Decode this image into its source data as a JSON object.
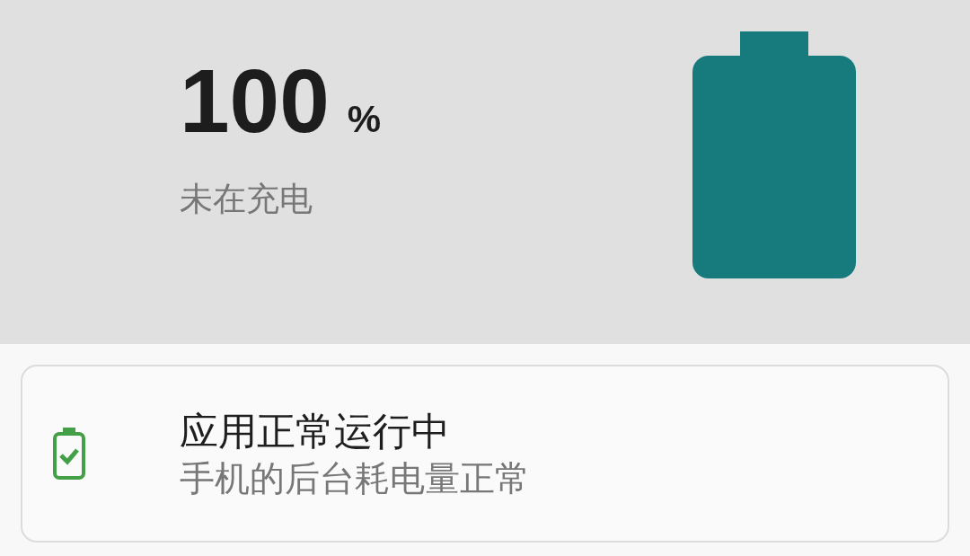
{
  "battery": {
    "percent": "100",
    "unit": "%",
    "status": "未在充电"
  },
  "card": {
    "title": "应用正常运行中",
    "subtitle": "手机的后台耗电量正常"
  }
}
